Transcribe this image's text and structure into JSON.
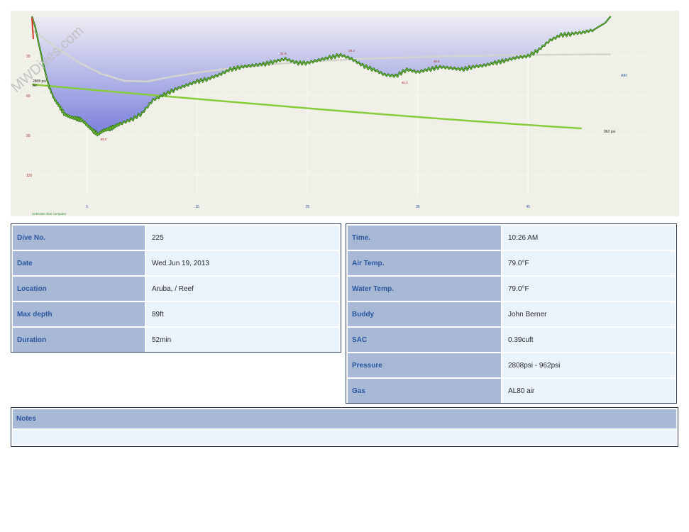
{
  "watermark": "MWDives.com",
  "profile": {
    "chart_data": {
      "type": "line",
      "title": "",
      "xlabel": "",
      "ylabel": "",
      "x_ticks": [
        "5",
        "15",
        "25",
        "35",
        "45"
      ],
      "y_ticks": [
        "30",
        "60",
        "90",
        "120"
      ],
      "xlim": [
        0,
        56
      ],
      "ylim": [
        0,
        135
      ],
      "depth": {
        "x": [
          0,
          0.3,
          0.6,
          1,
          1.5,
          2,
          2.5,
          3,
          3.5,
          4,
          4.5,
          5,
          5.5,
          6,
          6.5,
          7,
          7.5,
          8,
          9,
          10,
          11,
          12,
          13,
          14,
          15,
          16,
          17,
          18,
          19,
          20,
          21,
          22,
          23,
          24,
          25,
          26,
          27,
          28,
          29,
          30,
          31,
          32,
          33,
          34,
          35,
          36,
          37,
          38,
          39,
          40,
          41,
          42,
          43,
          44,
          45,
          46,
          47,
          48,
          49,
          50,
          51,
          52,
          52.5
        ],
        "y": [
          0,
          8,
          20,
          35,
          52,
          62,
          68,
          74,
          76,
          77,
          78,
          82,
          86,
          89,
          86,
          85,
          83,
          81,
          78,
          73,
          63,
          59,
          55,
          52,
          49,
          47,
          44,
          40,
          38,
          37,
          36,
          34,
          32,
          35,
          35,
          33,
          31,
          29,
          32,
          37,
          40,
          44,
          45,
          40,
          42,
          40,
          38,
          39,
          40,
          38,
          37,
          35,
          33,
          31,
          30,
          25,
          18,
          14,
          13,
          12,
          10,
          5,
          0
        ]
      },
      "pressure": {
        "start": "2808 psi",
        "end": "962 psi",
        "start_psi": 2808,
        "end_psi": 962
      },
      "depth_labels": [
        {
          "text": "89.0",
          "x": 6.5,
          "y": 89
        },
        {
          "text": "31.8",
          "x": 22.8,
          "y": 31
        },
        {
          "text": "29.3",
          "x": 29,
          "y": 29
        },
        {
          "text": "46.3",
          "x": 33.8,
          "y": 46
        },
        {
          "text": "38.8",
          "x": 36.7,
          "y": 37
        }
      ],
      "tag_air": "Air",
      "tag_air_right": "AIR",
      "computer": "Unknown dive computer"
    }
  },
  "left_table": [
    {
      "label": "Dive No.",
      "value": "225"
    },
    {
      "label": "Date",
      "value": "Wed Jun 19, 2013"
    },
    {
      "label": "Location",
      "value": "Aruba, / Reef"
    },
    {
      "label": "Max depth",
      "value": "89ft"
    },
    {
      "label": "Duration",
      "value": "52min"
    }
  ],
  "right_table": [
    {
      "label": "Time.",
      "value": "10:26 AM"
    },
    {
      "label": "Air Temp.",
      "value": "79.0°F"
    },
    {
      "label": "Water Temp.",
      "value": "79.0°F"
    },
    {
      "label": "Buddy",
      "value": "John Berner"
    },
    {
      "label": "SAC",
      "value": "0.39cuft"
    },
    {
      "label": "Pressure",
      "value": "2808psi - 962psi"
    },
    {
      "label": "Gas",
      "value": "AL80 air"
    }
  ],
  "notes": {
    "title": "Notes",
    "body": ""
  },
  "colors": {
    "chart_bg": "#f1f0e8",
    "depth_line": "#0f5a1e",
    "depth_line_highlight": "#8bd12a",
    "pressure_line": "#87cc3c",
    "fill_top": "#e8e8f0",
    "fill_bottom": "#7b7fdc",
    "label_bg": "#a7b9d5",
    "label_text": "#2b56a0",
    "value_bg": "#eaf2fc"
  }
}
